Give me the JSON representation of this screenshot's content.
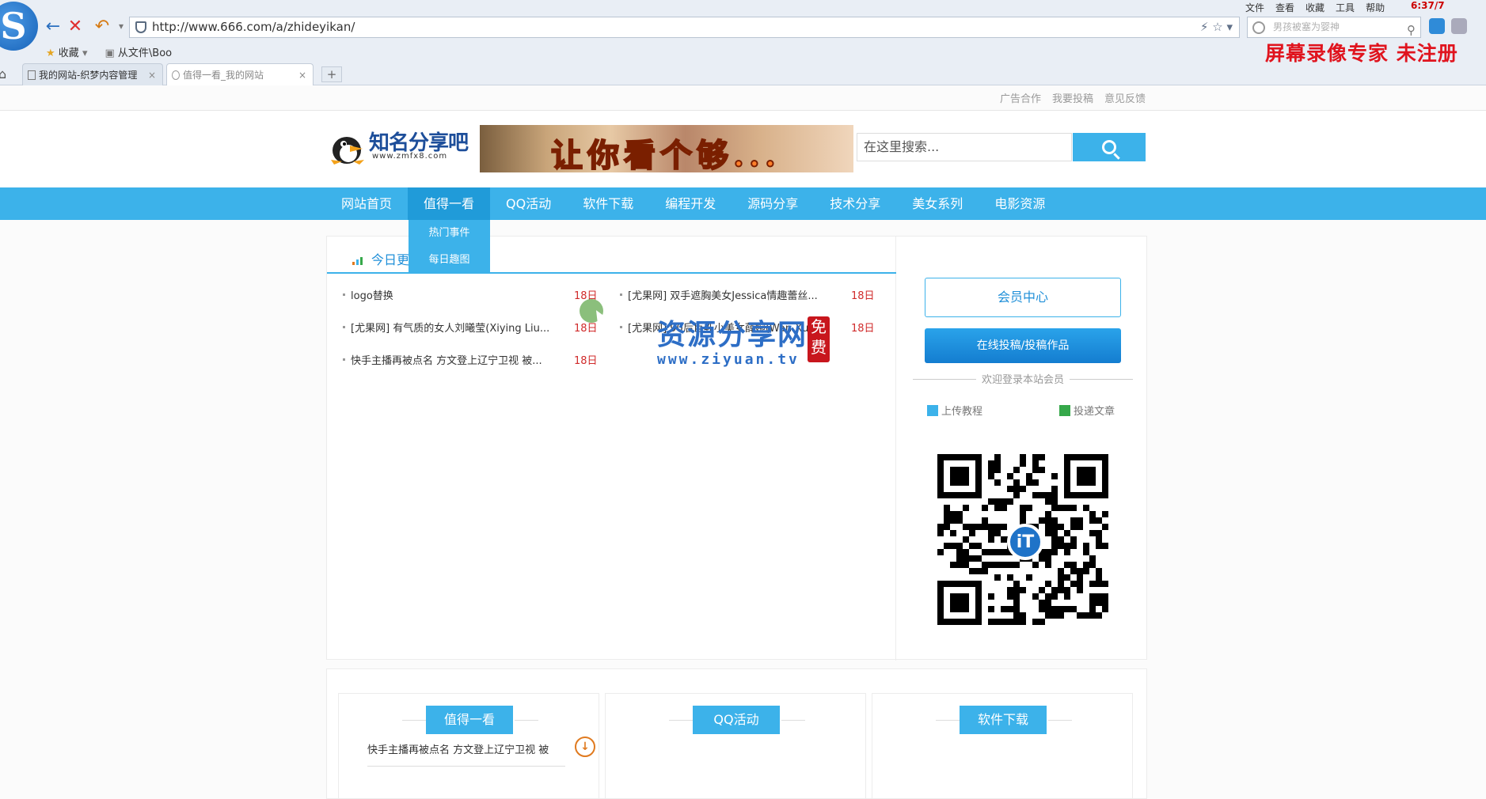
{
  "browser": {
    "logo_letter": "S",
    "url": "http://www.666.com/a/zhideyikan/",
    "search_placeholder": "男孩被塞为婴神",
    "menu": [
      "文件",
      "查看",
      "收藏",
      "工具",
      "帮助"
    ],
    "clock": "6:37/7",
    "bookmarks": [
      "收藏",
      "从文件\\Boo"
    ],
    "tabs": [
      {
        "label": "我的网站-织梦内容管理"
      },
      {
        "label": "值得一看_我的网站"
      }
    ],
    "newtab_label": "+",
    "recorder_watermark": "屏幕录像专家  未注册"
  },
  "site": {
    "toplinks": [
      "广告合作",
      "我要投稿",
      "意见反馈"
    ],
    "logo_name": "知名分享吧",
    "logo_url": "www.zmfx8.com",
    "banner_text": "让你看个够...",
    "search_placeholder": "在这里搜索...",
    "nav": [
      "网站首页",
      "值得一看",
      "QQ活动",
      "软件下载",
      "编程开发",
      "源码分享",
      "技术分享",
      "美女系列",
      "电影资源"
    ],
    "dropdown": [
      "热门事件",
      "每日趣图"
    ],
    "today_title": "今日更新",
    "news": [
      [
        {
          "title": "logo替换",
          "day": "18日"
        },
        {
          "title": "[尤果网] 双手遮胸美女Jessica情趣蕾丝...",
          "day": "18日"
        }
      ],
      [
        {
          "title": "[尤果网] 有气质的女人刘曦莹(Xiying Liu...",
          "day": "18日"
        },
        {
          "title": "[尤果网] 90后巨乳小美女薛婉(Wan Xue)...",
          "day": "18日"
        }
      ],
      [
        {
          "title": "快手主播再被点名 方文登上辽宁卫视 被...",
          "day": "18日"
        }
      ]
    ],
    "watermark": {
      "big": "资源分享网",
      "small": "www.ziyuan.tv",
      "seal": "免费"
    },
    "member_center": "会员中心",
    "submit_works": "在线投稿/投稿作品",
    "welcome": "欢迎登录本站会员",
    "upload_tutorial": "上传教程",
    "submit_article": "投递文章",
    "qr_center": "iT",
    "bottom_sections": [
      {
        "title": "值得一看",
        "item": "快手主播再被点名 方文登上辽宁卫视 被"
      },
      {
        "title": "QQ活动",
        "item": ""
      },
      {
        "title": "软件下载",
        "item": ""
      }
    ]
  },
  "colors": {
    "accent": "#3cb2ea",
    "nav_active": "#209bd9",
    "date_red": "#d02a2a",
    "recorder_red": "#e0141e"
  }
}
